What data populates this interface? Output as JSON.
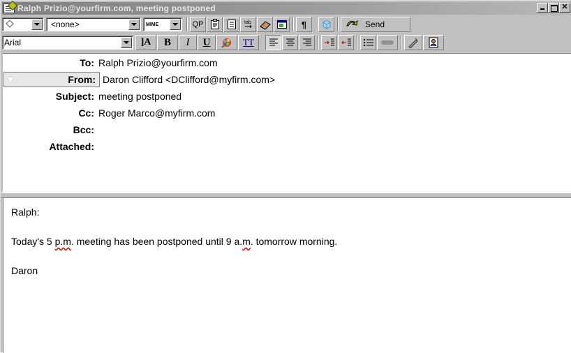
{
  "window": {
    "title": "Ralph Prizio@yourfirm.com, meeting postponed"
  },
  "toolbar1": {
    "priority_combo_value": "",
    "category_value": "<none>",
    "mime_label": "MIME",
    "qp_label": "QP",
    "send_label": "Send",
    "icons": [
      "diamond-icon",
      "clipboard-icon",
      "notebook-icon",
      "tab-stops-icon",
      "eraser-icon",
      "attach-window-icon",
      "pilcrow-icon",
      "cube-icon",
      "send-icon"
    ]
  },
  "toolbar2": {
    "font_value": "Arial",
    "font_size_glyph": "]A",
    "bold": "B",
    "italic": "I",
    "underline": "U",
    "color_glyph": "♣",
    "teletype": "TT",
    "icons": [
      "font-size-icon",
      "bold-icon",
      "italic-icon",
      "underline-icon",
      "color-icon",
      "teletype-icon",
      "align-left-icon",
      "align-center-icon",
      "align-right-icon",
      "outdent-icon",
      "indent-icon",
      "bullet-list-icon",
      "horizontal-rule-icon",
      "signature-icon",
      "address-book-icon"
    ]
  },
  "fields": {
    "to_label": "To:",
    "to_value": "Ralph Prizio@yourfirm.com",
    "from_label": "From:",
    "from_value": "Daron Clifford <DClifford@myfirm.com>",
    "subject_label": "Subject:",
    "subject_value": "meeting postponed",
    "cc_label": "Cc:",
    "cc_value": "Roger Marco@myfirm.com",
    "bcc_label": "Bcc:",
    "bcc_value": "",
    "attached_label": "Attached:",
    "attached_value": ""
  },
  "body": {
    "greeting": "Ralph:",
    "line1_pre": "Today's 5 ",
    "line1_pm": "p.m",
    "line1_mid": ". meeting has been postponed until 9 a.",
    "line1_m": "m",
    "line1_post": ". tomorrow morning.",
    "signoff": "Daron"
  },
  "colors": {
    "title_gradient_start": "#808080",
    "spellcheck_underline": "#d00000",
    "window_bg": "#c0c0c0"
  }
}
